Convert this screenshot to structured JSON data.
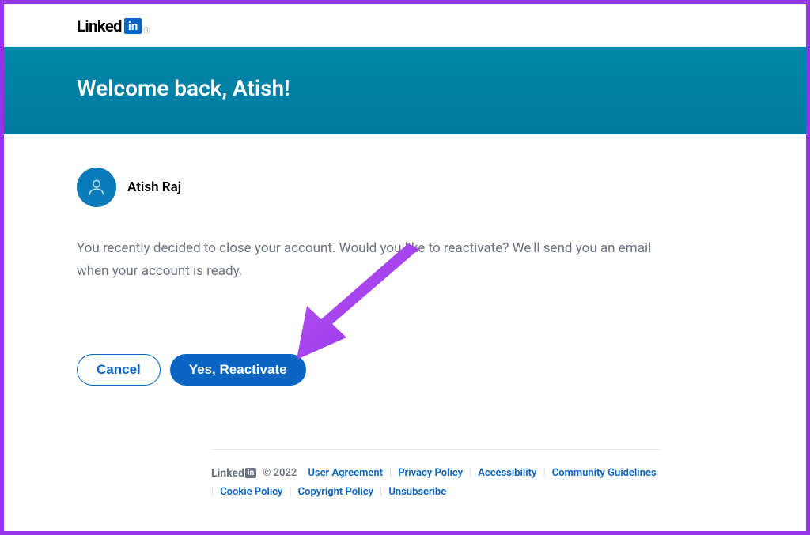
{
  "logo": {
    "text": "Linked",
    "in": "in",
    "reg": "®"
  },
  "banner": {
    "title": "Welcome back, Atish!"
  },
  "user": {
    "name": "Atish Raj"
  },
  "message": "You recently decided to close your account. Would you like to reactivate? We'll send you an email when your account is ready.",
  "buttons": {
    "cancel": "Cancel",
    "reactivate": "Yes, Reactivate"
  },
  "footer": {
    "logo_text": "Linked",
    "logo_in": "in",
    "copyright": "© 2022",
    "links": [
      "User Agreement",
      "Privacy Policy",
      "Accessibility",
      "Community Guidelines",
      "Cookie Policy",
      "Copyright Policy",
      "Unsubscribe"
    ]
  },
  "colors": {
    "accent": "#9333ea",
    "primary": "#0a66c2",
    "banner": "#0088a9"
  }
}
